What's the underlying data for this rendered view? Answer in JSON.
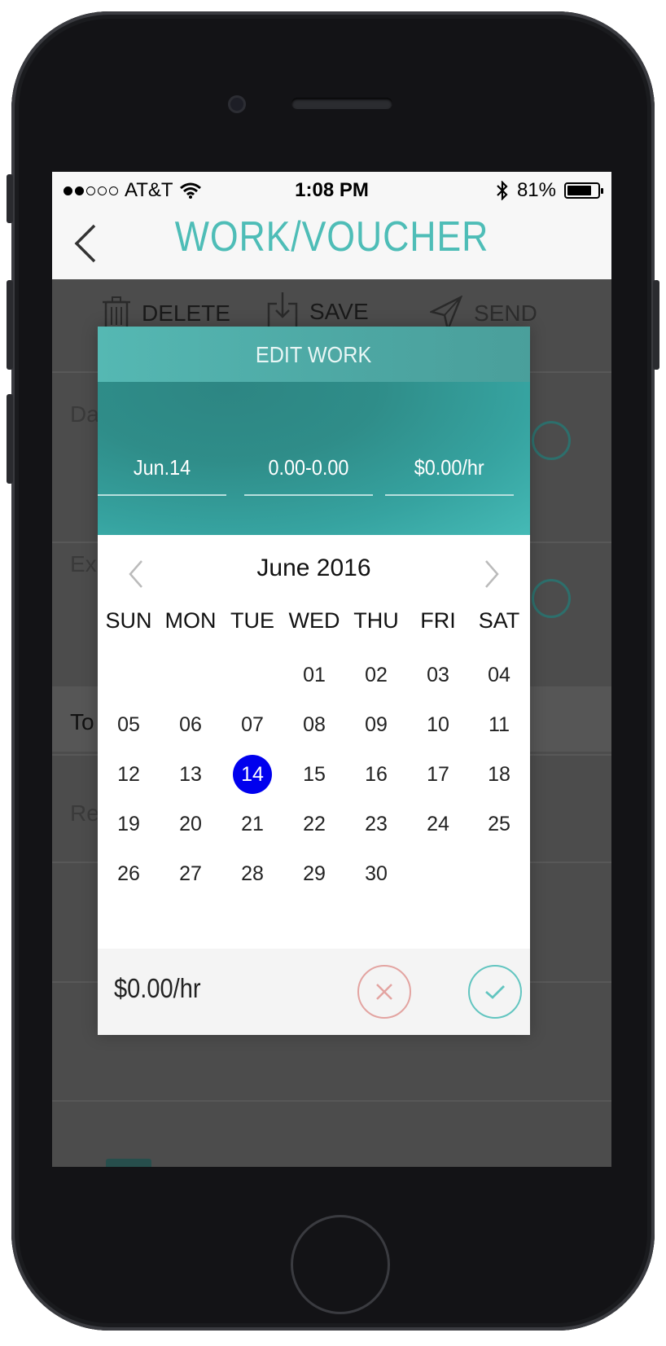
{
  "status_bar": {
    "carrier": "AT&T",
    "time": "1:08 PM",
    "battery_percent": "81%",
    "battery_level": 0.81,
    "signal_bars_filled": 2,
    "signal_bars_total": 5
  },
  "nav": {
    "title": "WORK/VOUCHER",
    "back_icon": "chevron-left-icon",
    "accent_color": "#4ebdb7"
  },
  "toolbar": {
    "delete_label": "DELETE",
    "save_label": "SAVE",
    "send_label": "SEND"
  },
  "background_partial": {
    "row1": "Da",
    "row2": "Exp",
    "row3": "To",
    "row4": "Rel"
  },
  "modal": {
    "title": "EDIT WORK",
    "date_field": "Jun.14",
    "time_field": "0.00-0.00",
    "rate_field": "$0.00/hr",
    "footer_rate": "$0.00/hr",
    "cancel_icon": "close-icon",
    "confirm_icon": "checkmark-icon"
  },
  "calendar": {
    "month_label": "June 2016",
    "weekdays": [
      "SUN",
      "MON",
      "TUE",
      "WED",
      "THU",
      "FRI",
      "SAT"
    ],
    "first_weekday_index": 3,
    "days": [
      "01",
      "02",
      "03",
      "04",
      "05",
      "06",
      "07",
      "08",
      "09",
      "10",
      "11",
      "12",
      "13",
      "14",
      "15",
      "16",
      "17",
      "18",
      "19",
      "20",
      "21",
      "22",
      "23",
      "24",
      "25",
      "26",
      "27",
      "28",
      "29",
      "30"
    ],
    "selected_day": "14",
    "selected_color": "#0000ee"
  }
}
